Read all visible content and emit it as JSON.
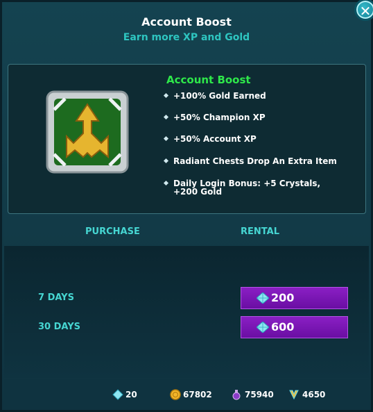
{
  "header": {
    "title": "Account Boost",
    "subtitle": "Earn more XP and Gold",
    "close_label": "✕"
  },
  "boost": {
    "name": "Account Boost",
    "icon": "trident-arrow-icon",
    "perks": [
      "+100% Gold Earned",
      "+50% Champion XP",
      "+50% Account XP",
      "Radiant Chests Drop An Extra Item",
      "Daily Login Bonus: +5 Crystals, +200 Gold"
    ]
  },
  "columns": {
    "purchase": "PURCHASE",
    "rental": "RENTAL"
  },
  "options": [
    {
      "days": "7 DAYS",
      "price": "200",
      "currency_icon": "crystal-icon"
    },
    {
      "days": "30 DAYS",
      "price": "600",
      "currency_icon": "crystal-icon"
    }
  ],
  "currencies": [
    {
      "icon": "crystal-icon",
      "value": "20"
    },
    {
      "icon": "gold-coin-icon",
      "value": "67802"
    },
    {
      "icon": "essence-potion-icon",
      "value": "75940"
    },
    {
      "icon": "radiant-essence-icon",
      "value": "4650"
    }
  ],
  "colors": {
    "accent_green": "#2ee84a",
    "accent_cyan": "#46d6d2",
    "button_purple": "#7a14b5"
  }
}
